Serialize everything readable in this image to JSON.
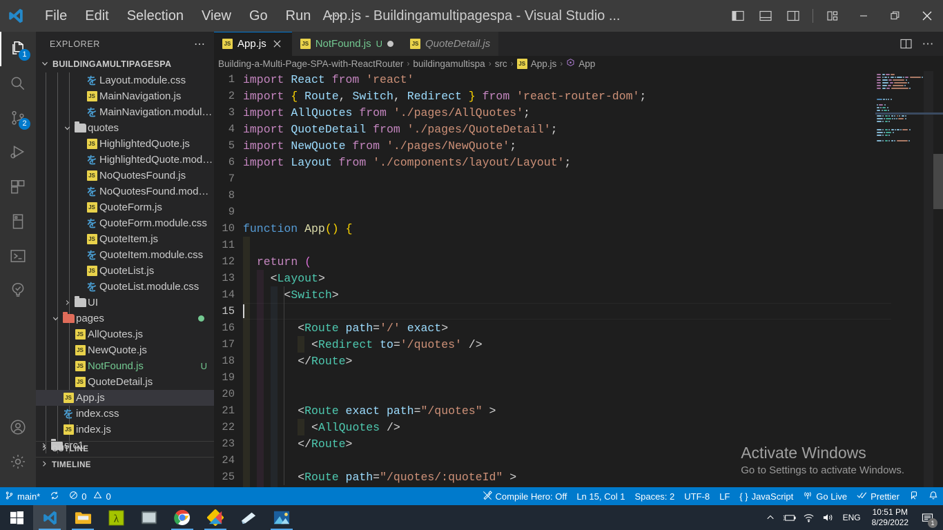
{
  "titlebar": {
    "menu": [
      "File",
      "Edit",
      "Selection",
      "View",
      "Go",
      "Run",
      "⋯"
    ],
    "window_title": "App.js - Buildingamultipagespa - Visual Studio ...",
    "logo_name": "vscode-logo"
  },
  "activitybar": {
    "items": [
      {
        "name": "explorer",
        "badge": "1",
        "active": true
      },
      {
        "name": "search",
        "badge": "",
        "active": false
      },
      {
        "name": "source-control",
        "badge": "2",
        "active": false
      },
      {
        "name": "run-and-debug",
        "badge": "",
        "active": false
      },
      {
        "name": "extensions",
        "badge": "",
        "active": false
      },
      {
        "name": "remote-explorer",
        "badge": "",
        "active": false
      },
      {
        "name": "terminal-panel",
        "badge": "",
        "active": false
      },
      {
        "name": "testing",
        "badge": "",
        "active": false
      }
    ],
    "bottom": [
      {
        "name": "accounts"
      },
      {
        "name": "settings"
      }
    ]
  },
  "sidebar": {
    "title": "EXPLORER",
    "more_label": "⋯",
    "root": "BUILDINGAMULTIPAGESPA",
    "files": [
      {
        "label": "Layout.module.css",
        "icon": "css",
        "indent": 4,
        "kind": "file"
      },
      {
        "label": "MainNavigation.js",
        "icon": "js",
        "indent": 4,
        "kind": "file"
      },
      {
        "label": "MainNavigation.module.css",
        "icon": "css",
        "indent": 4,
        "kind": "file"
      },
      {
        "label": "quotes",
        "icon": "folder",
        "indent": 3,
        "kind": "folder",
        "expanded": true
      },
      {
        "label": "HighlightedQuote.js",
        "icon": "js",
        "indent": 4,
        "kind": "file"
      },
      {
        "label": "HighlightedQuote.module...",
        "icon": "css",
        "indent": 4,
        "kind": "file"
      },
      {
        "label": "NoQuotesFound.js",
        "icon": "js",
        "indent": 4,
        "kind": "file"
      },
      {
        "label": "NoQuotesFound.module.c...",
        "icon": "css",
        "indent": 4,
        "kind": "file"
      },
      {
        "label": "QuoteForm.js",
        "icon": "js",
        "indent": 4,
        "kind": "file"
      },
      {
        "label": "QuoteForm.module.css",
        "icon": "css",
        "indent": 4,
        "kind": "file"
      },
      {
        "label": "QuoteItem.js",
        "icon": "js",
        "indent": 4,
        "kind": "file"
      },
      {
        "label": "QuoteItem.module.css",
        "icon": "css",
        "indent": 4,
        "kind": "file"
      },
      {
        "label": "QuoteList.js",
        "icon": "js",
        "indent": 4,
        "kind": "file"
      },
      {
        "label": "QuoteList.module.css",
        "icon": "css",
        "indent": 4,
        "kind": "file"
      },
      {
        "label": "UI",
        "icon": "folder",
        "indent": 3,
        "kind": "folder",
        "expanded": false
      },
      {
        "label": "pages",
        "icon": "folder-red",
        "indent": 2,
        "kind": "folder",
        "expanded": true,
        "dot": true
      },
      {
        "label": "AllQuotes.js",
        "icon": "js",
        "indent": 3,
        "kind": "file"
      },
      {
        "label": "NewQuote.js",
        "icon": "js",
        "indent": 3,
        "kind": "file"
      },
      {
        "label": "NotFound.js",
        "icon": "js",
        "indent": 3,
        "kind": "file",
        "modified": true,
        "status": "U"
      },
      {
        "label": "QuoteDetail.js",
        "icon": "js",
        "indent": 3,
        "kind": "file"
      },
      {
        "label": "App.js",
        "icon": "js",
        "indent": 2,
        "kind": "file",
        "selected": true
      },
      {
        "label": "index.css",
        "icon": "css",
        "indent": 2,
        "kind": "file"
      },
      {
        "label": "index.js",
        "icon": "js",
        "indent": 2,
        "kind": "file"
      },
      {
        "label": "src1",
        "icon": "folder",
        "indent": 1,
        "kind": "folder",
        "expanded": false
      }
    ],
    "sections": [
      "OUTLINE",
      "TIMELINE"
    ]
  },
  "editor": {
    "tabs": [
      {
        "label": "App.js",
        "icon": "js",
        "active": true,
        "italic": false,
        "status": "",
        "dirty": false,
        "closable": true
      },
      {
        "label": "NotFound.js",
        "icon": "js",
        "active": false,
        "italic": false,
        "status": "U",
        "modified": true,
        "dirty": true,
        "closable": false
      },
      {
        "label": "QuoteDetail.js",
        "icon": "js",
        "active": false,
        "italic": true,
        "status": "",
        "dirty": false,
        "closable": false
      }
    ],
    "tab_actions": [
      {
        "name": "split-editor-right-icon"
      },
      {
        "name": "more-actions-icon",
        "label": "⋯"
      }
    ],
    "breadcrumb": [
      {
        "label": "Building-a-Multi-Page-SPA-with-ReactRouter",
        "icon": ""
      },
      {
        "label": "buildingamultispa",
        "icon": ""
      },
      {
        "label": "src",
        "icon": ""
      },
      {
        "label": "App.js",
        "icon": "js"
      },
      {
        "label": "App",
        "icon": "symbol-class"
      }
    ],
    "breadcrumb_separator": "›",
    "first_line_number": 1,
    "cursor_line": 15,
    "code_lines": [
      {
        "n": 1,
        "tokens": [
          [
            "kw",
            "import "
          ],
          [
            "id",
            "React"
          ],
          [
            "kw",
            " from "
          ],
          [
            "str",
            "'react'"
          ]
        ]
      },
      {
        "n": 2,
        "tokens": [
          [
            "kw",
            "import "
          ],
          [
            "br-y",
            "{ "
          ],
          [
            "id",
            "Route"
          ],
          [
            "pun",
            ", "
          ],
          [
            "id",
            "Switch"
          ],
          [
            "pun",
            ", "
          ],
          [
            "id",
            "Redirect"
          ],
          [
            "br-y",
            " }"
          ],
          [
            "kw",
            " from "
          ],
          [
            "str",
            "'react-router-dom'"
          ],
          [
            "pun",
            ";"
          ]
        ]
      },
      {
        "n": 3,
        "tokens": [
          [
            "kw",
            "import "
          ],
          [
            "id",
            "AllQuotes"
          ],
          [
            "kw",
            " from "
          ],
          [
            "str",
            "'./pages/AllQuotes'"
          ],
          [
            "pun",
            ";"
          ]
        ]
      },
      {
        "n": 4,
        "tokens": [
          [
            "kw",
            "import "
          ],
          [
            "id",
            "QuoteDetail"
          ],
          [
            "kw",
            " from "
          ],
          [
            "str",
            "'./pages/QuoteDetail'"
          ],
          [
            "pun",
            ";"
          ]
        ]
      },
      {
        "n": 5,
        "tokens": [
          [
            "kw",
            "import "
          ],
          [
            "id",
            "NewQuote"
          ],
          [
            "kw",
            " from "
          ],
          [
            "str",
            "'./pages/NewQuote'"
          ],
          [
            "pun",
            ";"
          ]
        ]
      },
      {
        "n": 6,
        "tokens": [
          [
            "kw",
            "import "
          ],
          [
            "id",
            "Layout"
          ],
          [
            "kw",
            " from "
          ],
          [
            "str",
            "'./components/layout/Layout'"
          ],
          [
            "pun",
            ";"
          ]
        ]
      },
      {
        "n": 7,
        "tokens": []
      },
      {
        "n": 8,
        "tokens": []
      },
      {
        "n": 9,
        "tokens": []
      },
      {
        "n": 10,
        "tokens": [
          [
            "kw2",
            "function "
          ],
          [
            "fn",
            "App"
          ],
          [
            "br-y",
            "()"
          ],
          [
            "pun",
            " "
          ],
          [
            "br-y",
            "{"
          ]
        ]
      },
      {
        "n": 11,
        "tokens": []
      },
      {
        "n": 12,
        "tokens": [
          [
            "pun",
            "  "
          ],
          [
            "kw",
            "return "
          ],
          [
            "br-p",
            "("
          ]
        ]
      },
      {
        "n": 13,
        "tokens": [
          [
            "pun",
            "    "
          ],
          [
            "pun",
            "<"
          ],
          [
            "tag",
            "Layout"
          ],
          [
            "pun",
            ">"
          ]
        ]
      },
      {
        "n": 14,
        "tokens": [
          [
            "pun",
            "      "
          ],
          [
            "pun",
            "<"
          ],
          [
            "tag",
            "Switch"
          ],
          [
            "pun",
            ">"
          ]
        ]
      },
      {
        "n": 15,
        "tokens": []
      },
      {
        "n": 16,
        "tokens": [
          [
            "pun",
            "        "
          ],
          [
            "pun",
            "<"
          ],
          [
            "tag",
            "Route"
          ],
          [
            "pun",
            " "
          ],
          [
            "attr",
            "path"
          ],
          [
            "pun",
            "="
          ],
          [
            "str",
            "'/'"
          ],
          [
            "pun",
            " "
          ],
          [
            "attr",
            "exact"
          ],
          [
            "pun",
            ">"
          ]
        ]
      },
      {
        "n": 17,
        "tokens": [
          [
            "pun",
            "          "
          ],
          [
            "pun",
            "<"
          ],
          [
            "tag",
            "Redirect"
          ],
          [
            "pun",
            " "
          ],
          [
            "attr",
            "to"
          ],
          [
            "pun",
            "="
          ],
          [
            "str",
            "'/quotes'"
          ],
          [
            "pun",
            " />"
          ]
        ]
      },
      {
        "n": 18,
        "tokens": [
          [
            "pun",
            "        "
          ],
          [
            "pun",
            "</"
          ],
          [
            "tag",
            "Route"
          ],
          [
            "pun",
            ">"
          ]
        ]
      },
      {
        "n": 19,
        "tokens": []
      },
      {
        "n": 20,
        "tokens": []
      },
      {
        "n": 21,
        "tokens": [
          [
            "pun",
            "        "
          ],
          [
            "pun",
            "<"
          ],
          [
            "tag",
            "Route"
          ],
          [
            "pun",
            " "
          ],
          [
            "attr",
            "exact"
          ],
          [
            "pun",
            " "
          ],
          [
            "attr",
            "path"
          ],
          [
            "pun",
            "="
          ],
          [
            "str",
            "\"/quotes\""
          ],
          [
            "pun",
            " >"
          ]
        ]
      },
      {
        "n": 22,
        "tokens": [
          [
            "pun",
            "          "
          ],
          [
            "pun",
            "<"
          ],
          [
            "tag",
            "AllQuotes"
          ],
          [
            "pun",
            " />"
          ]
        ]
      },
      {
        "n": 23,
        "tokens": [
          [
            "pun",
            "        "
          ],
          [
            "pun",
            "</"
          ],
          [
            "tag",
            "Route"
          ],
          [
            "pun",
            ">"
          ]
        ]
      },
      {
        "n": 24,
        "tokens": []
      },
      {
        "n": 25,
        "tokens": [
          [
            "pun",
            "        "
          ],
          [
            "pun",
            "<"
          ],
          [
            "tag",
            "Route"
          ],
          [
            "pun",
            " "
          ],
          [
            "attr",
            "path"
          ],
          [
            "pun",
            "="
          ],
          [
            "str",
            "\"/quotes/:quoteId\""
          ],
          [
            "pun",
            " >"
          ]
        ]
      }
    ],
    "watermark": {
      "line1": "Activate Windows",
      "line2": "Go to Settings to activate Windows."
    }
  },
  "statusbar": {
    "left": [
      {
        "name": "branch",
        "icon": "source-control-icon",
        "label": "main*"
      },
      {
        "name": "sync",
        "icon": "sync-icon",
        "label": ""
      },
      {
        "name": "problems",
        "icon": "error-warning-icon",
        "label": "0  0"
      }
    ],
    "branch_label": "main*",
    "errors": "0",
    "warnings": "0",
    "right": [
      {
        "name": "compile-hero",
        "label": "Compile Hero: Off",
        "icon": "compile-hero-icon"
      },
      {
        "name": "cursor-position",
        "label": "Ln 15, Col 1",
        "icon": ""
      },
      {
        "name": "indentation",
        "label": "Spaces: 2",
        "icon": ""
      },
      {
        "name": "encoding",
        "label": "UTF-8",
        "icon": ""
      },
      {
        "name": "eol",
        "label": "LF",
        "icon": ""
      },
      {
        "name": "language-mode",
        "label": "JavaScript",
        "icon": "braces-icon"
      },
      {
        "name": "go-live",
        "label": "Go Live",
        "icon": "broadcast-icon"
      },
      {
        "name": "prettier",
        "label": "Prettier",
        "icon": "check-check-icon"
      },
      {
        "name": "feedback",
        "label": "",
        "icon": "feedback-icon"
      },
      {
        "name": "notifications",
        "label": "",
        "icon": "bell-icon"
      }
    ]
  },
  "taskbar": {
    "apps": [
      {
        "name": "start-button",
        "icon": "windows-logo"
      },
      {
        "name": "vscode",
        "icon": "vscode-logo",
        "running": true,
        "active": true
      },
      {
        "name": "file-explorer",
        "icon": "folder-icon",
        "running": true
      },
      {
        "name": "lambda-app",
        "icon": "lambda-icon",
        "running": false
      },
      {
        "name": "terminal",
        "icon": "terminal-icon",
        "running": false
      },
      {
        "name": "chrome",
        "icon": "chrome-icon",
        "running": true
      },
      {
        "name": "paint-3d",
        "icon": "paint-icon",
        "running": true
      },
      {
        "name": "sticky-notes",
        "icon": "note-icon",
        "running": false
      },
      {
        "name": "photos",
        "icon": "photos-icon",
        "running": true
      }
    ],
    "tray": {
      "chevron": "⌃",
      "language": "ENG",
      "time": "10:51 PM",
      "date": "8/29/2022",
      "notification_count": "1"
    }
  }
}
